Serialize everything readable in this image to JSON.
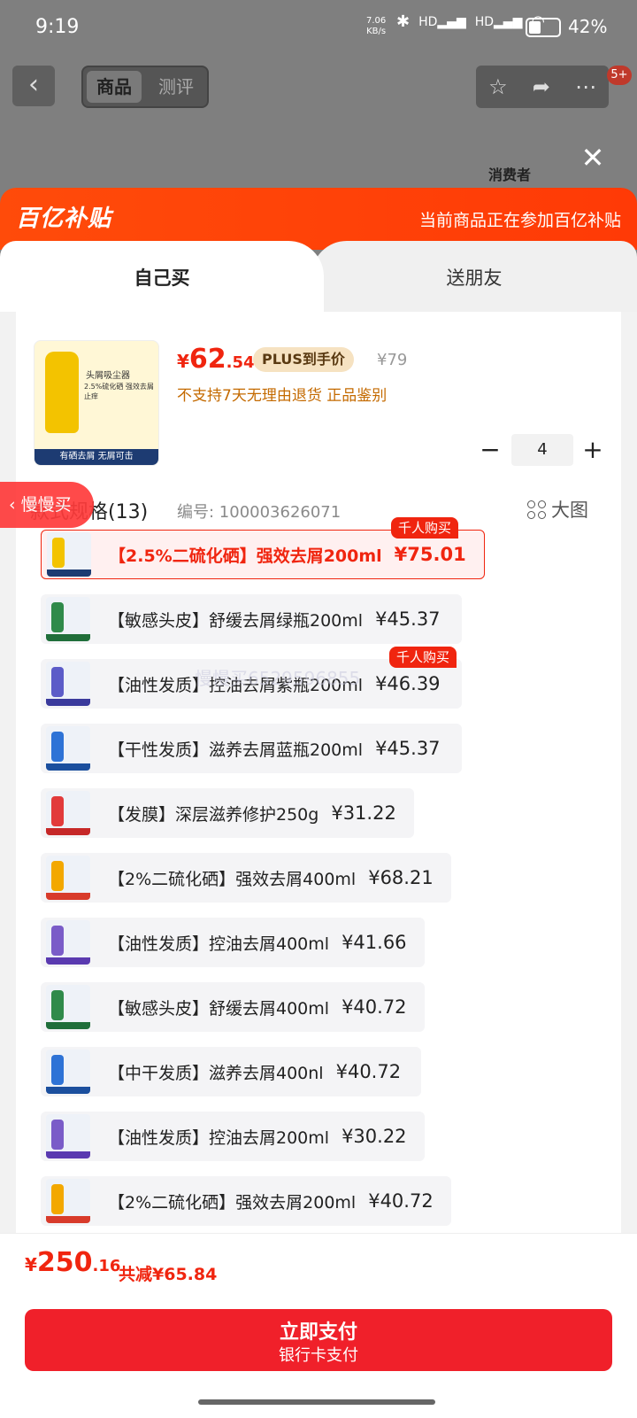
{
  "status_bar": {
    "time": "9:19",
    "net_speed_value": "7.06",
    "net_speed_unit": "KB/s",
    "hd1": "HD",
    "hd2": "HD",
    "battery": "42%",
    "battery_fraction": 0.42
  },
  "top": {
    "tabs": [
      "商品",
      "测评"
    ],
    "badge": "5+",
    "consumer_label": "消费者"
  },
  "banner": {
    "logo": "百亿补贴",
    "tip": "当前商品正在参加百亿补贴"
  },
  "sheet_tabs": [
    "自己买",
    "送朋友"
  ],
  "product": {
    "thumb_title": "头屑吸尘器",
    "thumb_sub": "2.5%硫化硒 强效去屑止痒",
    "thumb_strip": "有硒去屑 无屑可击",
    "price_currency": "¥",
    "price_int": "62",
    "price_dec": ".54",
    "plus_tag": "PLUS到手价",
    "orig_price": "¥79",
    "notice": "不支持7天无理由退货  正品鉴别"
  },
  "quantity": {
    "minus": "−",
    "value": "4",
    "plus": "+"
  },
  "spec": {
    "title": "款式规格(13)",
    "number": "编号: 100003626071",
    "big_image": "大图"
  },
  "floating_tag": "慢慢买",
  "watermark": "慢慢买6529596855",
  "options": [
    {
      "name": "【2.5%二硫化硒】强效去屑200ml",
      "price": "¥75.01",
      "hot": "千人购买",
      "selected": true,
      "color": "#f3c300",
      "strip": "#1d3b72"
    },
    {
      "name": "【敏感头皮】舒缓去屑绿瓶200ml",
      "price": "¥45.37",
      "hot": "",
      "selected": false,
      "color": "#2f8a4a",
      "strip": "#1f6e3a"
    },
    {
      "name": "【油性发质】控油去屑紫瓶200ml",
      "price": "¥46.39",
      "hot": "千人购买",
      "selected": false,
      "color": "#5c5cc8",
      "strip": "#3a3a9c"
    },
    {
      "name": "【干性发质】滋养去屑蓝瓶200ml",
      "price": "¥45.37",
      "hot": "",
      "selected": false,
      "color": "#2e73d6",
      "strip": "#1b4f9e"
    },
    {
      "name": "【发膜】深层滋养修护250g",
      "price": "¥31.22",
      "hot": "",
      "selected": false,
      "color": "#e23b3b",
      "strip": "#c62828"
    },
    {
      "name": "【2%二硫化硒】强效去屑400ml",
      "price": "¥68.21",
      "hot": "",
      "selected": false,
      "color": "#f3a800",
      "strip": "#d83b2b"
    },
    {
      "name": "【油性发质】控油去屑400ml",
      "price": "¥41.66",
      "hot": "",
      "selected": false,
      "color": "#7a5cc8",
      "strip": "#5a3ab0"
    },
    {
      "name": "【敏感头皮】舒缓去屑400ml",
      "price": "¥40.72",
      "hot": "",
      "selected": false,
      "color": "#2f8a4a",
      "strip": "#1f6e3a"
    },
    {
      "name": "【中干发质】滋养去屑400nl",
      "price": "¥40.72",
      "hot": "",
      "selected": false,
      "color": "#2e73d6",
      "strip": "#1b4f9e"
    },
    {
      "name": "【油性发质】控油去屑200ml",
      "price": "¥30.22",
      "hot": "",
      "selected": false,
      "color": "#7a5cc8",
      "strip": "#5a3ab0"
    },
    {
      "name": "【2%二硫化硒】强效去屑200ml",
      "price": "¥40.72",
      "hot": "",
      "selected": false,
      "color": "#f3a800",
      "strip": "#d83b2b"
    }
  ],
  "footer": {
    "total_currency": "¥",
    "total_int": "250",
    "total_dec": ".16",
    "saved": "共减¥65.84",
    "pay_label": "立即支付",
    "pay_sub": "银行卡支付"
  }
}
